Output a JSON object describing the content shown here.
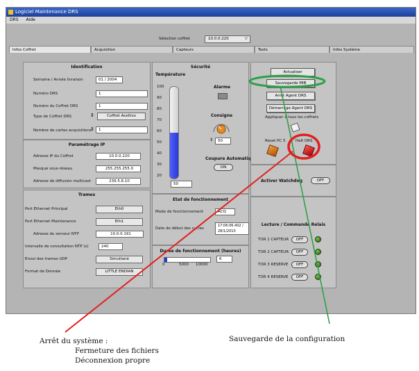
{
  "window": {
    "title": "Logiciel Maintenance DRS",
    "menu": [
      "DRS",
      "Aide"
    ]
  },
  "selection": {
    "label": "Sélection coffret",
    "value": "10.0.0.220"
  },
  "tabs": [
    "Infos Coffret",
    "Acquisition",
    "Capteurs",
    "Tests",
    "Infos Système"
  ],
  "identification": {
    "title": "Identification",
    "rows": [
      {
        "label": "Semaine / Année livraison",
        "value": "01 / 2004"
      },
      {
        "label": "Numéro DRS",
        "value": "1"
      },
      {
        "label": "Numéro du Coffret DRS",
        "value": "1"
      },
      {
        "label": "Type de Coffret DRS",
        "value": "Coffret Acellivo"
      },
      {
        "label": "Nombre de cartes acquisitions",
        "value": "1"
      }
    ]
  },
  "ip": {
    "title": "Paramétrage IP",
    "rows": [
      {
        "label": "Adresse IP du Coffret",
        "value": "10.0.0.220"
      },
      {
        "label": "Masque sous-réseau",
        "value": "255.255.255.0"
      },
      {
        "label": "Adresse de diffusion multicast",
        "value": "239.5.6.10"
      }
    ]
  },
  "trames": {
    "title": "Trames",
    "rows": [
      {
        "label": "Port Ethernet Principal",
        "value": "Eth0"
      },
      {
        "label": "Port Ethernet Maintenance",
        "value": "Eth1"
      },
      {
        "label": "Adresse du serveur NTP",
        "value": "10.0.0.191"
      },
      {
        "label": "Intervalle de consultation NTP (s)",
        "value": "240"
      },
      {
        "label": "Envoi des trames UDP",
        "value": "Simultané"
      },
      {
        "label": "Format de Donnée",
        "value": "LITTLE ENDIAN"
      }
    ]
  },
  "securite": {
    "title": "Sécurité",
    "temperature_label": "Température",
    "temperature_value": "50",
    "temperature_fraction": 0.5,
    "scale": [
      "100",
      "90",
      "80",
      "70",
      "60",
      "50",
      "40",
      "30",
      "20"
    ],
    "alarme_label": "Alarme",
    "consigne_label": "Consigne",
    "consigne_value": "50",
    "coupure_label": "Coupure Automatique",
    "coupure_state": "ON"
  },
  "etat": {
    "title": "Etat de fonctionnement",
    "mode_label": "Mode de fonctionnement",
    "mode_value": "ACQ",
    "date_label": "Date de début des cycles",
    "date_value": "17:06:06.402 / 28/1/2010"
  },
  "duree": {
    "title": "Durée de fonctionnement (heures)",
    "ticks": [
      "0",
      "5000",
      "10000"
    ],
    "value": "6"
  },
  "actions": {
    "actualiser": "Actualiser",
    "sauvegarde": "Sauvegarde MIB",
    "arret": "Arrêt Agent DRS",
    "demarrage": "Démarrage Agent DRS",
    "appliquer": "Appliquer à tous les coffrets",
    "reset": "Reset PC 5",
    "halt": "Halt DRS"
  },
  "watchdog": {
    "label": "Activer Watchdog",
    "state": "OFF"
  },
  "relais": {
    "title": "Lecture / Commande Relais",
    "rows": [
      {
        "label": "TOR 1 CAPTEUR",
        "state": "OFF"
      },
      {
        "label": "TOR 2 CAPTEUR",
        "state": "OFF"
      },
      {
        "label": "TOR 3 RESERVE",
        "state": "OFF"
      },
      {
        "label": "TOR 4 RESERVE",
        "state": "OFF"
      }
    ]
  },
  "captions": {
    "left_title": "Arrêt du système :",
    "left_line1": "Fermeture des fichiers",
    "left_line2": "Déconnexion propre",
    "right": "Sauvegarde de la configuration"
  },
  "colors": {
    "annotation_red": "#e02020",
    "annotation_green": "#2ea04a",
    "thermo_blue": "#2a3ad0"
  }
}
